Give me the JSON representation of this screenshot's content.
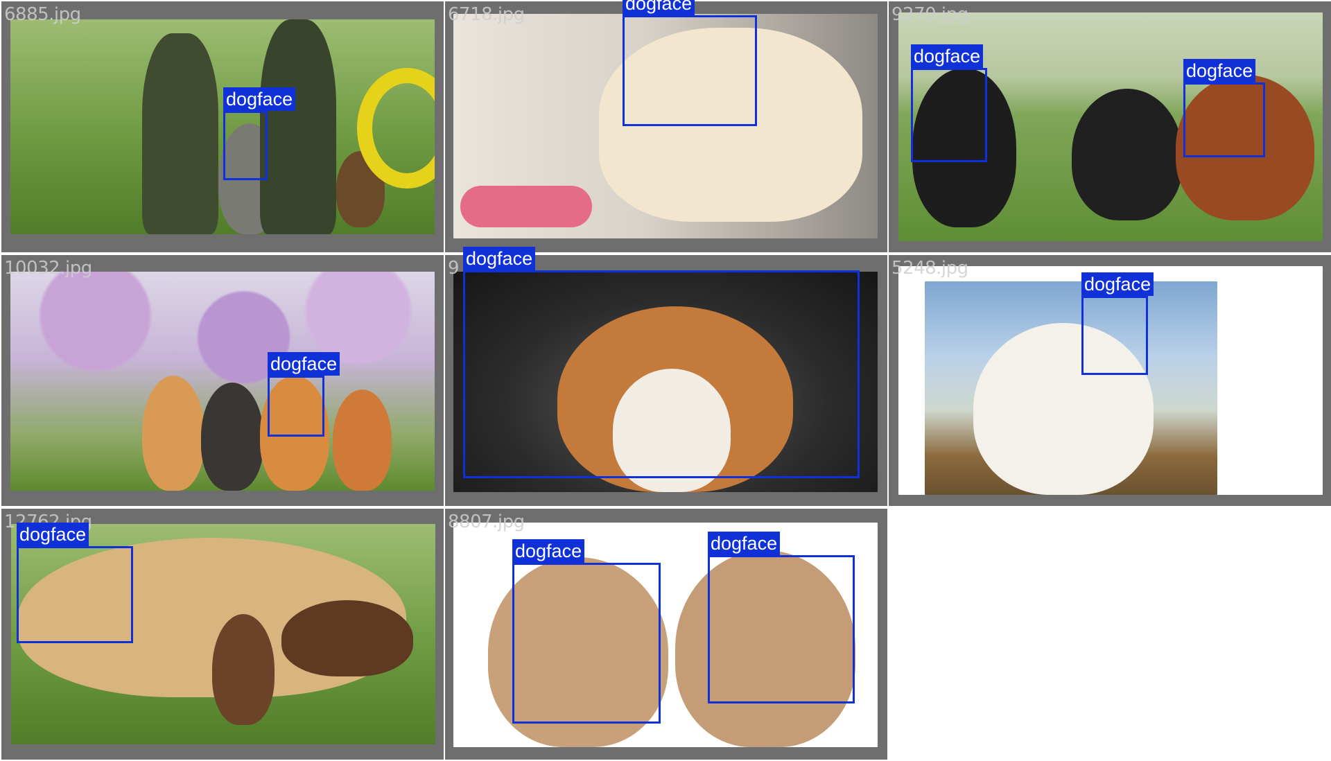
{
  "tiles": [
    {
      "filename": "6885.jpg",
      "detections": [
        "dogface"
      ]
    },
    {
      "filename": "6718.jpg",
      "detections": [
        "dogface"
      ]
    },
    {
      "filename": "9270.jpg",
      "detections": [
        "dogface",
        "dogface"
      ]
    },
    {
      "filename": "10032.jpg",
      "detections": [
        "dogface"
      ]
    },
    {
      "filename": "9",
      "detections": [
        "dogface"
      ]
    },
    {
      "filename": "5248.jpg",
      "detections": [
        "dogface"
      ]
    },
    {
      "filename": "12762.jpg",
      "detections": [
        "dogface"
      ]
    },
    {
      "filename": "8807.jpg",
      "detections": [
        "dogface",
        "dogface"
      ]
    }
  ],
  "colors": {
    "box": "#1030d8",
    "tile_bg": "#6e6e6e",
    "filename_text": "#cfcfcf"
  }
}
